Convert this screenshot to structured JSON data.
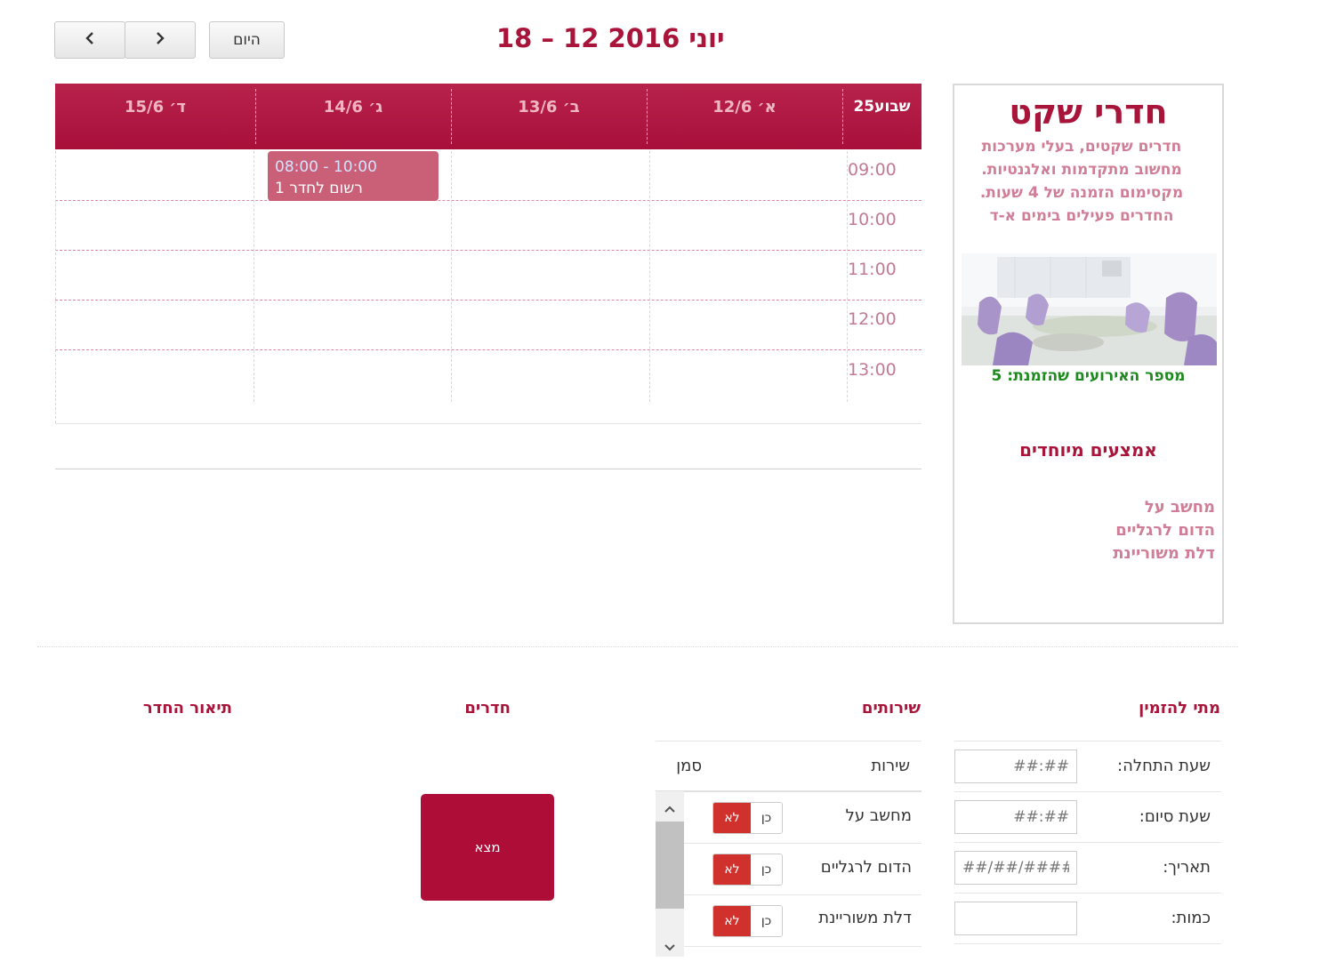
{
  "toolbar": {
    "today_label": "היום",
    "prev_icon": "‹",
    "next_icon": "›",
    "title": "יוני 2016 12 – 18"
  },
  "calendar": {
    "headers": [
      "שבוע25",
      "א׳ 12/6",
      "ב׳ 13/6",
      "ג׳ 14/6",
      "ד׳ 15/6"
    ],
    "times": [
      "09:00",
      "10:00",
      "11:00",
      "12:00",
      "13:00"
    ],
    "event": {
      "time": "08:00 - 10:00",
      "title": "רשום לחדר 1"
    }
  },
  "panel": {
    "title": "חדרי שקט",
    "description": "חדרים שקטים, בעלי מערכות מחשוב מתקדמות ואלגנטיות. מקסימום הזמנה של 4 שעות. החדרים פעילים בימים א-ד",
    "count": "מספר האירועים שהזמנת: 5",
    "special_title": "אמצעים מיוחדים",
    "amenities": [
      "מחשב על",
      "הדום לרגליים",
      "דלת משוריינת"
    ]
  },
  "form": {
    "when_title": "מתי להזמין",
    "services_title": "שירותים",
    "rooms_title": "חדרים",
    "desc_title": "תיאור החדר",
    "start_label": "שעת התחלה:",
    "start_placeholder": "##:##",
    "end_label": "שעת סיום:",
    "end_placeholder": "##:##",
    "date_label": "תאריך:",
    "date_placeholder": "##/##/####",
    "qty_label": "כמות:",
    "service_col": "שירות",
    "mark_col": "סמן",
    "services": [
      {
        "name": "מחשב על",
        "yes": "כן",
        "no": "לא"
      },
      {
        "name": "הדום לרגליים",
        "yes": "כן",
        "no": "לא"
      },
      {
        "name": "דלת משוריינת",
        "yes": "כן",
        "no": "לא"
      }
    ],
    "find_label": "מצא"
  },
  "colors": {
    "accent": "#a8143a",
    "header": "#b01a44",
    "event": "#ca5f78",
    "toggle_no": "#d0312d"
  }
}
